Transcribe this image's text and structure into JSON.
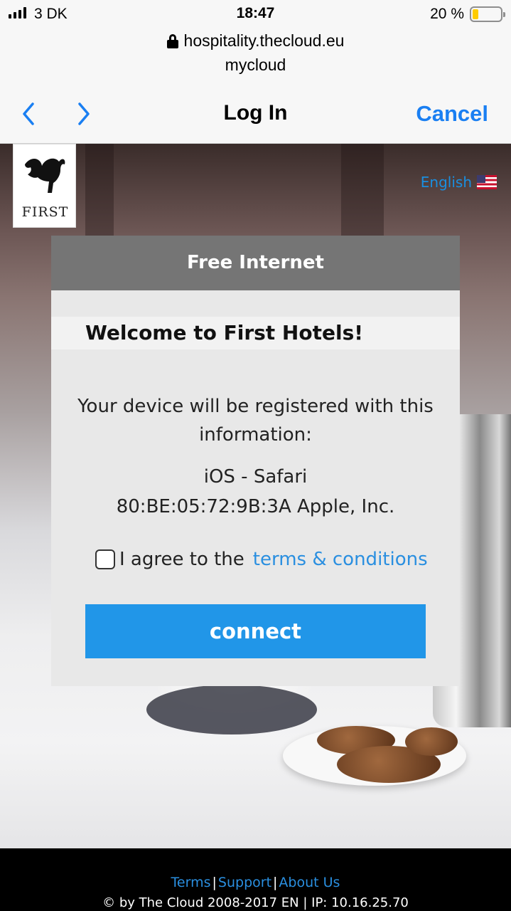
{
  "status_bar": {
    "carrier": "3 DK",
    "time": "18:47",
    "battery_percent": "20 %",
    "battery_color": "#ffcc00"
  },
  "browser": {
    "url": "hospitality.thecloud.eu",
    "page_name": "mycloud",
    "nav_title": "Log In",
    "cancel_label": "Cancel",
    "accent_color": "#1a7ff2"
  },
  "page": {
    "logo_text": "FIRST",
    "language_label": "English",
    "card": {
      "header": "Free Internet",
      "welcome": "Welcome to First Hotels!",
      "info_line1": "Your device will be registered with this",
      "info_line2": "information:",
      "device_line1": "iOS - Safari",
      "device_line2": "80:BE:05:72:9B:3A Apple, Inc.",
      "agree_text": "I agree to the",
      "terms_link": "terms & conditions",
      "connect_label": "connect",
      "connect_color": "#2196e8"
    }
  },
  "footer": {
    "links": [
      "Terms",
      "Support",
      "About Us"
    ],
    "copyright": "© by The Cloud 2008-2017 EN | IP: 10.16.25.70"
  }
}
